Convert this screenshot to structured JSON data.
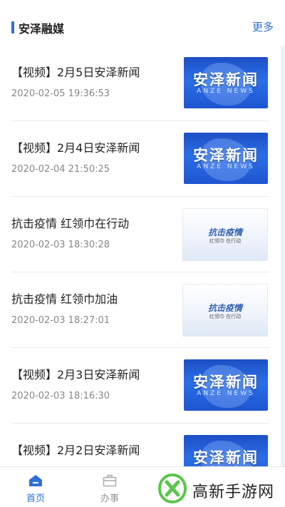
{
  "header": {
    "title": "安泽融媒",
    "more": "更多"
  },
  "items": [
    {
      "title": "【视频】2月5日安泽新闻",
      "time": "2020-02-05 19:36:53",
      "thumb": "news"
    },
    {
      "title": "【视频】2月4日安泽新闻",
      "time": "2020-02-04 21:50:25",
      "thumb": "news"
    },
    {
      "title": "抗击疫情 红领巾在行动",
      "time": "2020-02-03 18:30:28",
      "thumb": "kang"
    },
    {
      "title": "抗击疫情 红领巾加油",
      "time": "2020-02-03 18:27:01",
      "thumb": "kang"
    },
    {
      "title": "【视频】2月3日安泽新闻",
      "time": "2020-02-03 18:16:30",
      "thumb": "news"
    },
    {
      "title": "【视频】2月2日安泽新闻",
      "time": "",
      "thumb": "news"
    }
  ],
  "thumbs": {
    "news": {
      "title": "安泽新闻",
      "sub": "ANZE NEWS"
    },
    "kang": {
      "title": "抗击疫情",
      "sub": "红领巾 在行动"
    }
  },
  "tabs": [
    {
      "label": "首页",
      "icon": "home-icon",
      "active": true
    },
    {
      "label": "办事",
      "icon": "briefcase-icon",
      "active": false
    }
  ],
  "watermark": {
    "text": "高新手游网"
  },
  "colors": {
    "accent": "#2f6fd6",
    "text": "#222222",
    "muted": "#888888"
  }
}
